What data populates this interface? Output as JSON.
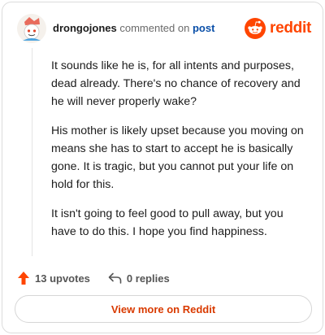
{
  "comment": {
    "author": "drongojones",
    "action_text": "commented on",
    "target_link": "post",
    "paragraphs": [
      "It sounds like he is, for all intents and purposes, dead already. There's no chance of recovery and he will never properly wake?",
      "His mother is likely upset because you moving on means she has to start to accept he is basically gone. It is tragic, but you cannot put your life on hold for this.",
      "It isn't going to feel good to pull away, but you have to do this. I hope you find happiness."
    ],
    "upvotes_label": "13 upvotes",
    "replies_label": "0 replies"
  },
  "brand": {
    "wordmark": "reddit",
    "color": "#ff4500"
  },
  "footer": {
    "view_more_label": "View more on Reddit"
  },
  "icons": {
    "avatar": "snoo-avatar-icon",
    "brand": "reddit-logo-icon",
    "upvote": "upvote-arrow-icon",
    "reply": "reply-arrow-icon"
  },
  "colors": {
    "accent": "#ff4500",
    "link": "#0a4fa8",
    "button_text": "#d93a00"
  }
}
